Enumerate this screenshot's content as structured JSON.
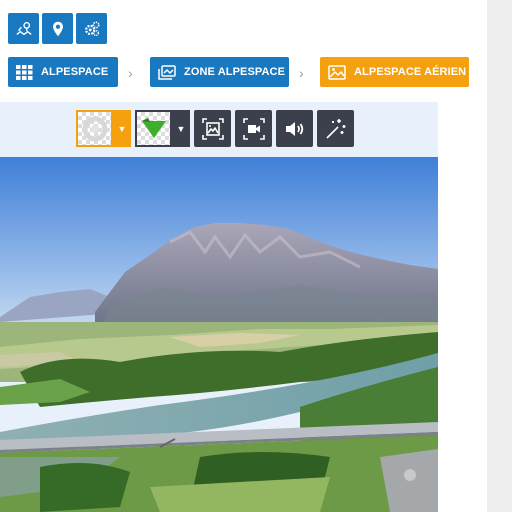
{
  "top_icons": [
    {
      "name": "map-icon"
    },
    {
      "name": "location-pin-icon"
    },
    {
      "name": "settings-gears-icon"
    }
  ],
  "breadcrumb": {
    "items": [
      {
        "label": "ALPESPACE",
        "icon": "grid-icon",
        "color": "#1878c0"
      },
      {
        "label": "ZONE ALPESPACE",
        "icon": "layers-icon",
        "color": "#1878c0"
      },
      {
        "label": "ALPESPACE AÉRIEN",
        "icon": "image-icon",
        "color": "#f5a00f"
      }
    ],
    "separator": "›"
  },
  "viewer": {
    "toolbar": [
      {
        "name": "marker-style-picker",
        "icon": "circle-target-icon"
      },
      {
        "name": "layer-style-picker",
        "icon": "green-triangle-icon"
      },
      {
        "name": "image-frame-button",
        "icon": "image-frame-icon"
      },
      {
        "name": "video-frame-button",
        "icon": "video-camera-icon"
      },
      {
        "name": "sound-button",
        "icon": "speaker-icon"
      },
      {
        "name": "effects-button",
        "icon": "magic-wand-icon"
      }
    ],
    "panorama": {
      "subject": "aerial-view-mountain-river"
    }
  },
  "colors": {
    "primary": "#1878c0",
    "accent": "#f5a00f",
    "toolbar": "#3c3f4c"
  }
}
